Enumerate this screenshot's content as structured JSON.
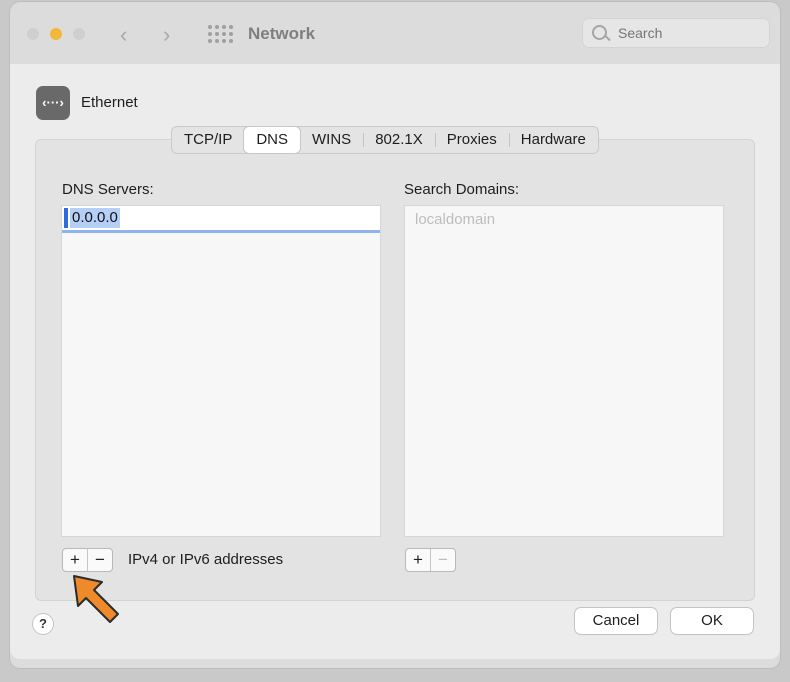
{
  "window": {
    "title": "Network"
  },
  "search": {
    "placeholder": "Search"
  },
  "service": {
    "icon_glyph": "‹···›",
    "name": "Ethernet"
  },
  "tabs": [
    "TCP/IP",
    "DNS",
    "WINS",
    "802.1X",
    "Proxies",
    "Hardware"
  ],
  "active_tab": "DNS",
  "dns": {
    "label": "DNS Servers:",
    "servers": [
      "0.0.0.0"
    ],
    "add_label": "+",
    "remove_label": "−",
    "hint": "IPv4 or IPv6 addresses"
  },
  "domains": {
    "label": "Search Domains:",
    "entries": [
      "localdomain"
    ],
    "add_label": "+",
    "remove_label": "−"
  },
  "help_label": "?",
  "buttons": {
    "cancel": "Cancel",
    "ok": "OK"
  },
  "colors": {
    "accent": "#2c6be0",
    "selection": "#b5cff7",
    "arrow": "#ef8a2a"
  }
}
